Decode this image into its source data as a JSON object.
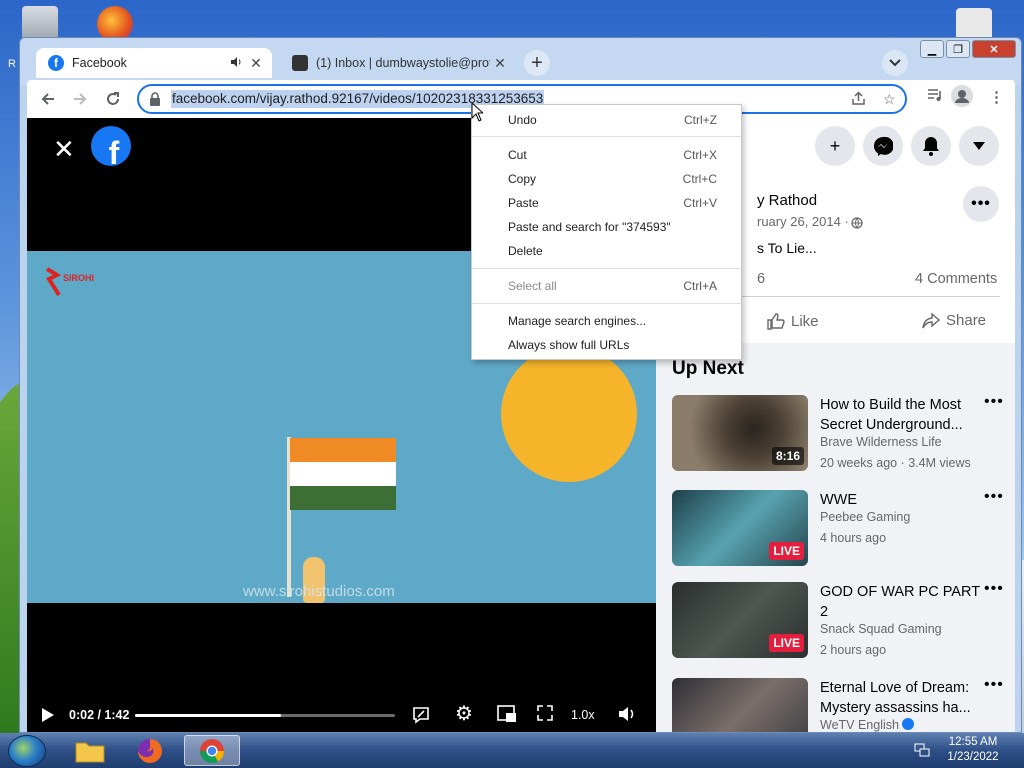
{
  "desktop": {
    "label_partial": "R"
  },
  "browser": {
    "tabs": [
      {
        "title": "Facebook",
        "active": true
      },
      {
        "title": "(1) Inbox | dumbwaystolie@prot",
        "active": false
      }
    ],
    "new_tab_label": "+",
    "url": "facebook.com/vijay.rathod.92167/videos/10202318331253653"
  },
  "video": {
    "watermark": "www.sirohistudios.com",
    "logo_text": "SIROHI",
    "time": "0:02 / 1:42",
    "progress": 0.56,
    "speed": "1.0x",
    "colors": {
      "sky": "#5fa9c8",
      "sun": "#f6b42a",
      "saffron": "#f08a24",
      "white": "#ffffff",
      "green": "#3c6e35"
    }
  },
  "post": {
    "author_partial": "y Rathod",
    "date_partial": "ruary 26, 2014 ·",
    "caption_partial": "s To Lie...",
    "reactions_partial": "6",
    "comments": "4 Comments",
    "like_label": "Like",
    "share_label": "Share"
  },
  "upnext": {
    "heading": "Up Next",
    "items": [
      {
        "title": "How to Build the Most Secret Underground...",
        "channel": "Brave Wilderness Life",
        "meta": "20 weeks ago · 3.4M views",
        "badge": "8:16",
        "live": false,
        "thumb": "#7a6a5a"
      },
      {
        "title": "WWE",
        "channel": "Peebee Gaming",
        "meta": "4 hours ago",
        "badge": "LIVE",
        "live": true,
        "thumb": "#3d7f8a"
      },
      {
        "title": "GOD OF WAR PC PART 2",
        "channel": "Snack Squad Gaming",
        "meta": "2 hours ago",
        "badge": "LIVE",
        "live": true,
        "thumb": "#3b4040"
      },
      {
        "title": "Eternal Love of Dream: Mystery assassins ha...",
        "channel": "WeTV English",
        "meta": "",
        "badge": "",
        "live": false,
        "thumb": "#5b5555"
      }
    ]
  },
  "context_menu": {
    "items": [
      {
        "label": "Undo",
        "shortcut": "Ctrl+Z",
        "disabled": false
      },
      {
        "label": "Cut",
        "shortcut": "Ctrl+X",
        "disabled": false
      },
      {
        "label": "Copy",
        "shortcut": "Ctrl+C",
        "disabled": false
      },
      {
        "label": "Paste",
        "shortcut": "Ctrl+V",
        "disabled": false
      },
      {
        "label": "Paste and search for \"374593\"",
        "shortcut": "",
        "disabled": false
      },
      {
        "label": "Delete",
        "shortcut": "",
        "disabled": false
      },
      {
        "label": "Select all",
        "shortcut": "Ctrl+A",
        "disabled": true
      },
      {
        "label": "Manage search engines...",
        "shortcut": "",
        "disabled": false
      },
      {
        "label": "Always show full URLs",
        "shortcut": "",
        "disabled": false
      }
    ]
  },
  "taskbar": {
    "time": "12:55 AM",
    "date": "1/23/2022"
  }
}
